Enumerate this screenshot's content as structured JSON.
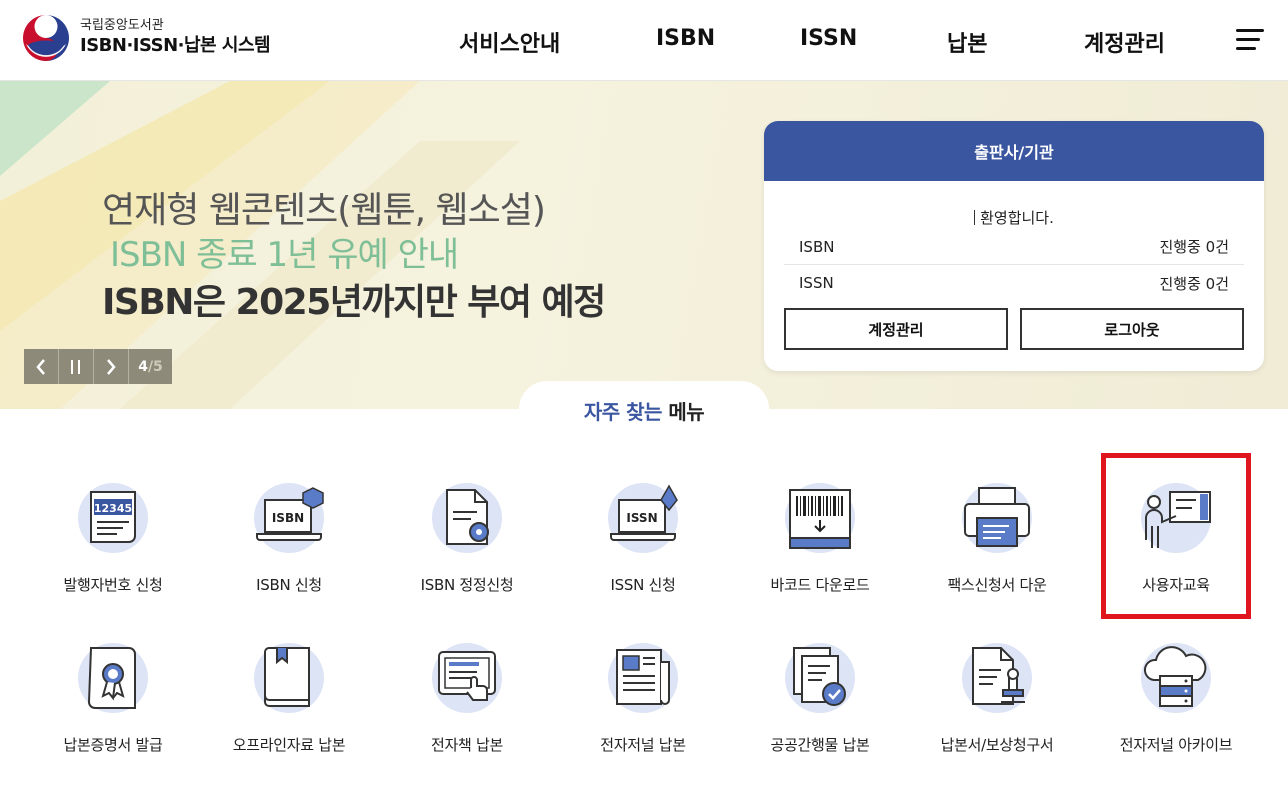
{
  "header": {
    "org": "국립중앙도서관",
    "title": "ISBN·ISSN·납본 시스템",
    "nav": [
      "서비스안내",
      "ISBN",
      "ISSN",
      "납본",
      "계정관리"
    ]
  },
  "hero": {
    "line1": "연재형 웹콘텐츠(웹툰, 웹소설)",
    "line2": "ISBN 종료 1년 유예 안내",
    "line3": "ISBN은 2025년까지만 부여 예정",
    "slide_current": "4",
    "slide_total": "/5"
  },
  "card": {
    "title": "출판사/기관",
    "welcome": "환영합니다.",
    "rows": [
      {
        "label": "ISBN",
        "value": "진행중 0건"
      },
      {
        "label": "ISSN",
        "value": "진행중 0건"
      }
    ],
    "btn_account": "계정관리",
    "btn_logout": "로그아웃"
  },
  "favorites": {
    "title_blue": "자주 찾는",
    "title_dark": "메뉴",
    "items": [
      {
        "label": "발행자번호 신청",
        "icon": "publisher-number-icon",
        "code": "12345"
      },
      {
        "label": "ISBN 신청",
        "icon": "isbn-laptop-icon",
        "code": "ISBN"
      },
      {
        "label": "ISBN 정정신청",
        "icon": "document-gear-icon"
      },
      {
        "label": "ISSN 신청",
        "icon": "issn-laptop-icon",
        "code": "ISSN"
      },
      {
        "label": "바코드 다운로드",
        "icon": "barcode-icon"
      },
      {
        "label": "팩스신청서 다운",
        "icon": "fax-icon"
      },
      {
        "label": "사용자교육",
        "icon": "presentation-icon"
      },
      {
        "label": "납본증명서 발급",
        "icon": "certificate-icon"
      },
      {
        "label": "오프라인자료 납본",
        "icon": "book-icon"
      },
      {
        "label": "전자책 납본",
        "icon": "tablet-touch-icon"
      },
      {
        "label": "전자저널 납본",
        "icon": "newspaper-icon"
      },
      {
        "label": "공공간행물 납본",
        "icon": "documents-check-icon"
      },
      {
        "label": "납본서/보상청구서",
        "icon": "document-stamp-icon"
      },
      {
        "label": "전자저널 아카이브",
        "icon": "cloud-server-icon"
      }
    ]
  },
  "colors": {
    "brand_blue": "#3a56a0",
    "hero_green": "#7fbf97",
    "highlight_red": "#e0161e"
  }
}
